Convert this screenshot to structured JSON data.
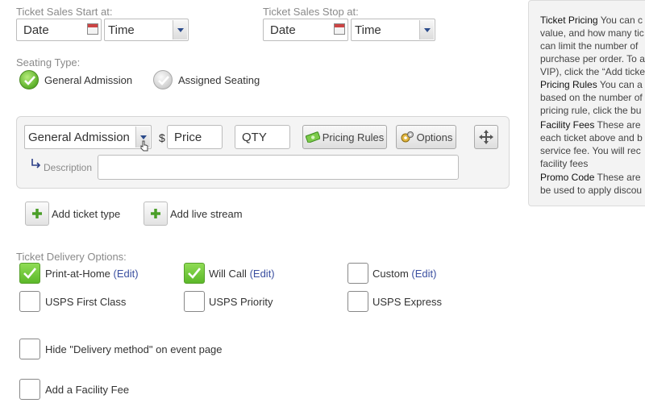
{
  "sales_start": {
    "label": "Ticket Sales Start at:",
    "date_value": "Date",
    "time_value": "Time"
  },
  "sales_stop": {
    "label": "Ticket Sales Stop at:",
    "date_value": "Date",
    "time_value": "Time"
  },
  "seating": {
    "label": "Seating Type:",
    "options": [
      {
        "label": "General Admission",
        "selected": true
      },
      {
        "label": "Assigned Seating",
        "selected": false
      }
    ]
  },
  "ticket_row": {
    "type_value": "General Admission",
    "currency": "$",
    "price_placeholder": "Price",
    "qty_placeholder": "QTY",
    "pricing_rules_label": "Pricing Rules",
    "options_label": "Options",
    "description_label": "Description"
  },
  "actions": {
    "add_ticket_type": "Add ticket type",
    "add_live_stream": "Add live stream"
  },
  "delivery": {
    "label": "Ticket Delivery Options:",
    "edit_label": "(Edit)",
    "options": [
      {
        "label": "Print-at-Home",
        "checked": true
      },
      {
        "label": "Will Call",
        "checked": true
      },
      {
        "label": "Custom",
        "checked": false
      },
      {
        "label": "USPS First Class",
        "checked": false
      },
      {
        "label": "USPS Priority",
        "checked": false
      },
      {
        "label": "USPS Express",
        "checked": false
      }
    ]
  },
  "hide_delivery": {
    "label": "Hide \"Delivery method\" on event page",
    "checked": false
  },
  "facility_fee": {
    "label": "Add a Facility Fee",
    "checked": false
  },
  "sidebar": {
    "items": [
      {
        "title": "Ticket Pricing",
        "lines": [
          " You can c",
          "value, and how many tic",
          "can limit the number of",
          "purchase per order. To a",
          "VIP), click the “Add ticke"
        ]
      },
      {
        "title": "Pricing Rules",
        "lines": [
          " You can a",
          "based on the number of",
          "pricing rule, click the bu"
        ]
      },
      {
        "title": "Facility Fees",
        "lines": [
          " These are",
          "each ticket above and b",
          "service fee. You will rec",
          "facility fees"
        ]
      },
      {
        "title": "Promo Code",
        "lines": [
          " These are",
          "be used to apply discou"
        ]
      }
    ]
  },
  "colors": {
    "accent_green": "#5cb82a",
    "edit_link": "#3a4fa0",
    "panel_bg": "#f4f4f4"
  }
}
